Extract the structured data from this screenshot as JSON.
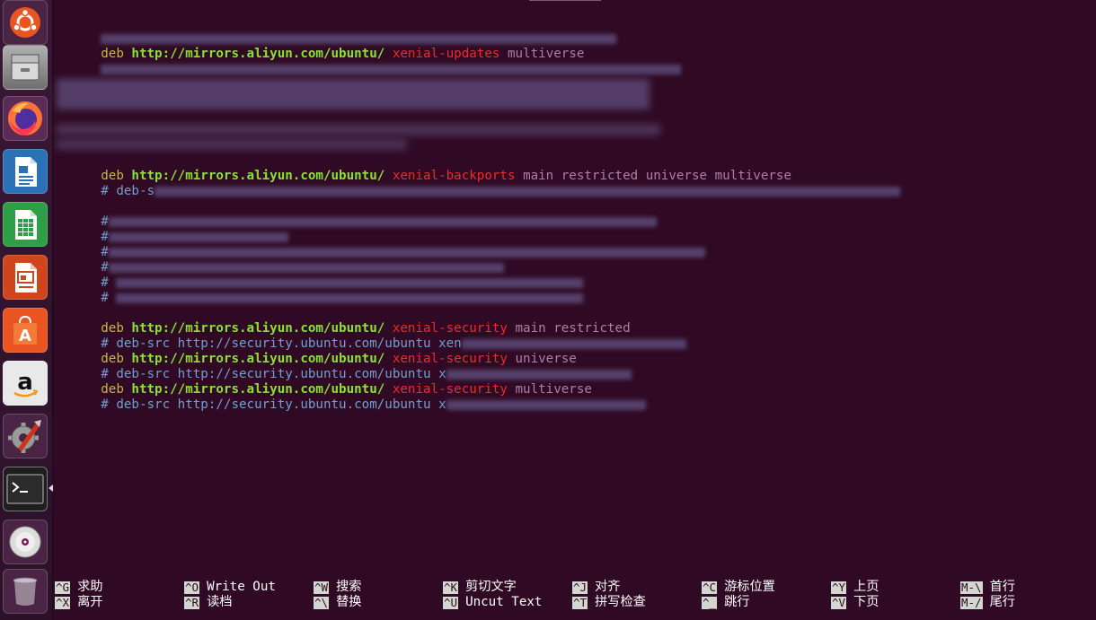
{
  "launcher": {
    "items": [
      {
        "name": "ubuntu-dash-icon",
        "color": "#e95420"
      },
      {
        "name": "files-icon",
        "color": "#8c8c8c"
      },
      {
        "name": "firefox-icon",
        "color": "#ff7139"
      },
      {
        "name": "libreoffice-writer-icon",
        "color": "#2a72b5"
      },
      {
        "name": "libreoffice-calc-icon",
        "color": "#2e9f47"
      },
      {
        "name": "libreoffice-impress-icon",
        "color": "#d0451b"
      },
      {
        "name": "software-center-icon",
        "color": "#e95420"
      },
      {
        "name": "amazon-icon",
        "color": "#f8f8f8"
      },
      {
        "name": "system-settings-icon",
        "color": "#c0392b"
      },
      {
        "name": "terminal-icon",
        "color": "#2b2b2b"
      },
      {
        "name": "dvd-icon",
        "color": "#cccccc"
      },
      {
        "name": "trash-icon",
        "color": "#b5a9b5"
      }
    ]
  },
  "terminal": {
    "colors": {
      "background": "#300a24",
      "deb": "#c8b93a",
      "url": "#8ae234",
      "suite": "#ef2929",
      "component": "#ad7fa8",
      "comment": "#729fcf"
    },
    "lines": {
      "l2": {
        "deb": "deb",
        "url": "http://mirrors.aliyun.com/ubuntu/",
        "suite": "xenial-updates",
        "comp": "multiverse"
      },
      "l10": {
        "deb": "deb",
        "url": "http://mirrors.aliyun.com/ubuntu/",
        "suite": "xenial-backports",
        "comp": "main restricted universe multiverse"
      },
      "l11": {
        "text": "# deb-s"
      },
      "l13": {
        "text": "#"
      },
      "l14": {
        "text": "#"
      },
      "l15": {
        "text": "#"
      },
      "l16": {
        "text": "#"
      },
      "l17": {
        "text": "#"
      },
      "l18": {
        "text": "#"
      },
      "l20": {
        "deb": "deb",
        "url": "http://mirrors.aliyun.com/ubuntu/",
        "suite": "xenial-security",
        "comp": "main restricted"
      },
      "l21": {
        "text": "# deb-src http://security.ubuntu.com/ubuntu xen"
      },
      "l22": {
        "deb": "deb",
        "url": "http://mirrors.aliyun.com/ubuntu/",
        "suite": "xenial-security",
        "comp": "universe"
      },
      "l23": {
        "text": "# deb-src http://security.ubuntu.com/ubuntu x"
      },
      "l24": {
        "deb": "deb",
        "url": "http://mirrors.aliyun.com/ubuntu/",
        "suite": "xenial-security",
        "comp": "multiverse"
      },
      "l25": {
        "text": "# deb-src http://security.ubuntu.com/ubuntu x"
      }
    }
  },
  "shortcuts": [
    {
      "key": "^G",
      "label": "求助"
    },
    {
      "key": "^X",
      "label": "离开"
    },
    {
      "key": "^O",
      "label": "Write Out"
    },
    {
      "key": "^R",
      "label": "读档"
    },
    {
      "key": "^W",
      "label": "搜索"
    },
    {
      "key": "^\\",
      "label": "替换"
    },
    {
      "key": "^K",
      "label": "剪切文字"
    },
    {
      "key": "^U",
      "label": "Uncut Text"
    },
    {
      "key": "^J",
      "label": "对齐"
    },
    {
      "key": "^T",
      "label": "拼写检查"
    },
    {
      "key": "^C",
      "label": "游标位置"
    },
    {
      "key": "^_",
      "label": "跳行"
    },
    {
      "key": "^Y",
      "label": "上页"
    },
    {
      "key": "^V",
      "label": "下页"
    },
    {
      "key": "M-\\",
      "label": "首行"
    },
    {
      "key": "M-/",
      "label": "尾行"
    }
  ]
}
